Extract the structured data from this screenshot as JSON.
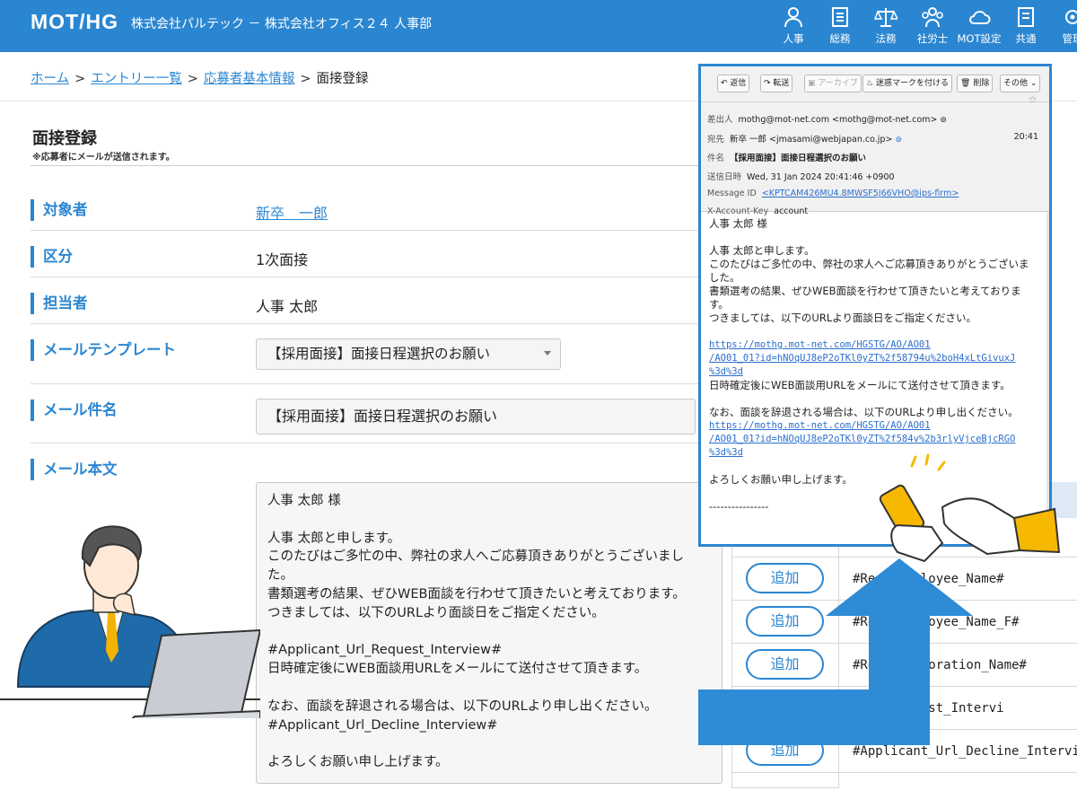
{
  "header": {
    "logo": "MOT/HG",
    "company": "株式会社パルテック － 株式会社オフィス２４ 人事部",
    "nav": [
      {
        "label": "人事",
        "icon": "people-icon"
      },
      {
        "label": "総務",
        "icon": "document-icon"
      },
      {
        "label": "法務",
        "icon": "scales-icon"
      },
      {
        "label": "社労士",
        "icon": "group-icon"
      },
      {
        "label": "MOT設定",
        "icon": "cloud-icon"
      },
      {
        "label": "共通",
        "icon": "list-icon"
      },
      {
        "label": "管理",
        "icon": "admin-icon"
      }
    ]
  },
  "breadcrumb": {
    "home": "ホーム",
    "entries": "エントリー一覧",
    "applicant": "応募者基本情報",
    "current": "面接登録",
    "sep": ">"
  },
  "page": {
    "title": "面接登録",
    "notice": "※応募者にメールが送信されます。"
  },
  "form": {
    "target_label": "対象者",
    "target_value": "新卒　一郎",
    "category_label": "区分",
    "category_value": "1次面接",
    "staff_label": "担当者",
    "staff_value": "人事 太郎",
    "template_label": "メールテンプレート",
    "template_value": "【採用面接】面接日程選択のお願い",
    "subject_label": "メール件名",
    "subject_value": "【採用面接】面接日程選択のお願い",
    "body_label": "メール本文",
    "body_lines": [
      "人事 太郎 様",
      "",
      "人事 太郎と申します。",
      "このたびはご多忙の中、弊社の求人へご応募頂きありがとうございまし",
      "た。",
      "書類選考の結果、ぜひWEB面談を行わせて頂きたいと考えております。",
      "つきましては、以下のURLより面談日をご指定ください。",
      "",
      "#Applicant_Url_Request_Interview#",
      "日時確定後にWEB面談用URLをメールにて送付させて頂きます。",
      "",
      "なお、面談を辞退される場合は、以下のURLより申し出ください。",
      "#Applicant_Url_Decline_Interview#",
      "",
      "よろしくお願い申し上げます。"
    ]
  },
  "placeholders": {
    "add_label": "追加",
    "rows": [
      "#Re        r_Employee_Name#",
      "#Re        r_Employee_Name_F#",
      "#Re        r_Corporation_Name#",
      "                 _Url_Request_Intervi",
      "#Applicant_Url_Decline_Intervi"
    ]
  },
  "mail": {
    "toolbar": {
      "reply": "返信",
      "forward": "転送",
      "archive": "アーカイブ",
      "junk": "迷惑マークを付ける",
      "delete": "削除",
      "other": "その他"
    },
    "from_label": "差出人",
    "from_value": "mothg@mot-net.com <mothg@mot-net.com>",
    "to_label": "宛先",
    "to_value": "新卒 一郎 <jmasami@webjapan.co.jp>",
    "time": "20:41",
    "subject_label": "件名",
    "subject_value": "【採用面接】面接日程選択のお願い",
    "date_label": "送信日時",
    "date_value": "Wed, 31 Jan 2024 20:41:46 +0900",
    "msgid_label": "Message ID",
    "msgid_value": "<KPTCAM426MU4.8MWSF5J66VHO@ips-firm>",
    "xacc_label": "X-Account-Key",
    "xacc_value": "account",
    "body": {
      "greeting": "人事 太郎 様",
      "l1": "人事 太郎と申します。",
      "l2": "このたびはご多忙の中、弊社の求人へご応募頂きありがとうございま",
      "l3": "した。",
      "l4": "書類選考の結果、ぜひWEB面談を行わせて頂きたいと考えておりま",
      "l5": "す。",
      "l6": "つきましては、以下のURLより面談日をご指定ください。",
      "url1a": "https://mothg.mot-net.com/HGSTG/AO/AO01",
      "url1b": "/AO01_01?id=hNOqUJ8eP2oTKl0yZT%2f58794u%2boH4xLtGivuxJ",
      "url1c": "%3d%3d",
      "l7": "日時確定後にWEB面談用URLをメールにて送付させて頂きます。",
      "l8": "なお、面談を辞退される場合は、以下のURLより申し出ください。",
      "url2a": "https://mothg.mot-net.com/HGSTG/AO/AO01",
      "url2b": "/AO01_01?id=hNOqUJ8eP2oTKl0yZT%2f584v%2b3rlyVjceBjcRGO",
      "url2c": "%3d%3d",
      "l9": "よろしくお願い申し上げます。",
      "sig": "----------------"
    }
  },
  "colors": {
    "header_bg": "#2b86d1",
    "accent": "#2b86d1",
    "arrow": "#2e8bd6",
    "phone": "#f6b800"
  }
}
